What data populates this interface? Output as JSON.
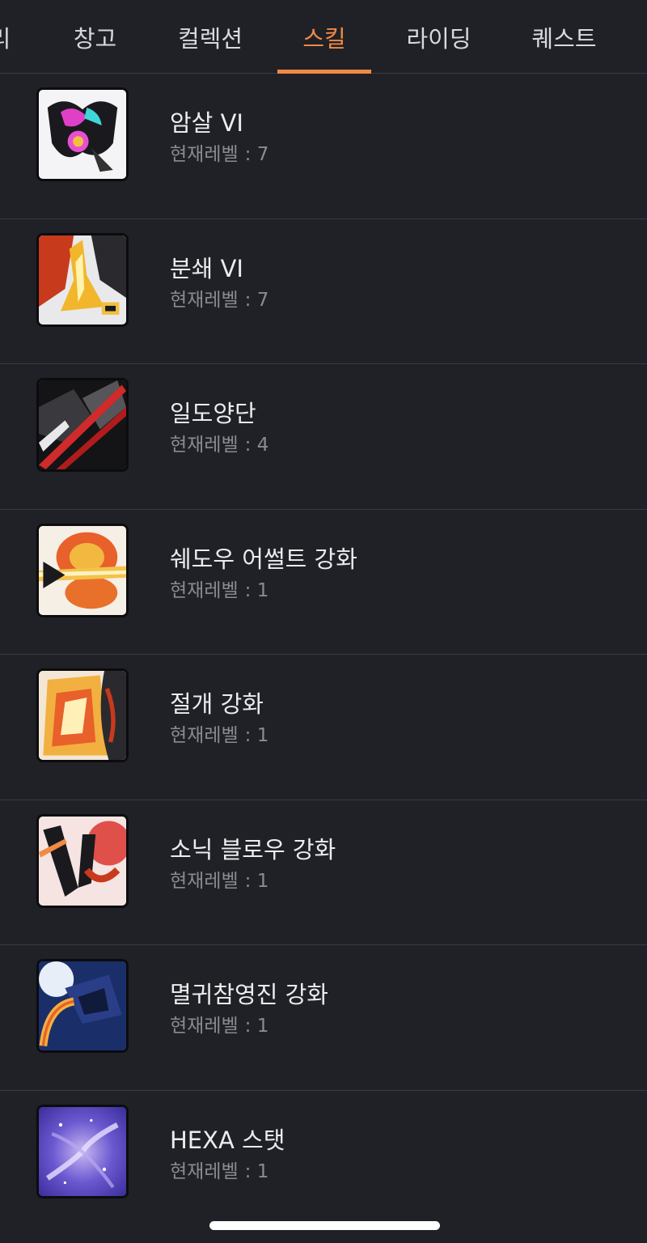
{
  "tabs": [
    {
      "label": "리",
      "active": false
    },
    {
      "label": "창고",
      "active": false
    },
    {
      "label": "컬렉션",
      "active": false
    },
    {
      "label": "스킬",
      "active": true
    },
    {
      "label": "라이딩",
      "active": false
    },
    {
      "label": "퀘스트",
      "active": false
    }
  ],
  "colors": {
    "background": "#202127",
    "accent": "#f08a44",
    "divider": "#3a3b42",
    "secondary_text": "#8a8b92"
  },
  "level_label": "현재레벨",
  "level_separator": ":",
  "skills": [
    {
      "name": "암살 VI",
      "level": "7",
      "icon": "assassinate-skill-icon"
    },
    {
      "name": "분쇄 VI",
      "level": "7",
      "icon": "crush-skill-icon"
    },
    {
      "name": "일도양단",
      "level": "4",
      "icon": "cleave-skill-icon"
    },
    {
      "name": "쉐도우 어썰트 강화",
      "level": "1",
      "icon": "shadow-assault-skill-icon"
    },
    {
      "name": "절개 강화",
      "level": "1",
      "icon": "incision-skill-icon"
    },
    {
      "name": "소닉 블로우 강화",
      "level": "1",
      "icon": "sonic-blow-skill-icon"
    },
    {
      "name": "멸귀참영진 강화",
      "level": "1",
      "icon": "demon-slash-skill-icon"
    },
    {
      "name": "HEXA 스탯",
      "level": "1",
      "icon": "hexa-stat-icon"
    }
  ]
}
